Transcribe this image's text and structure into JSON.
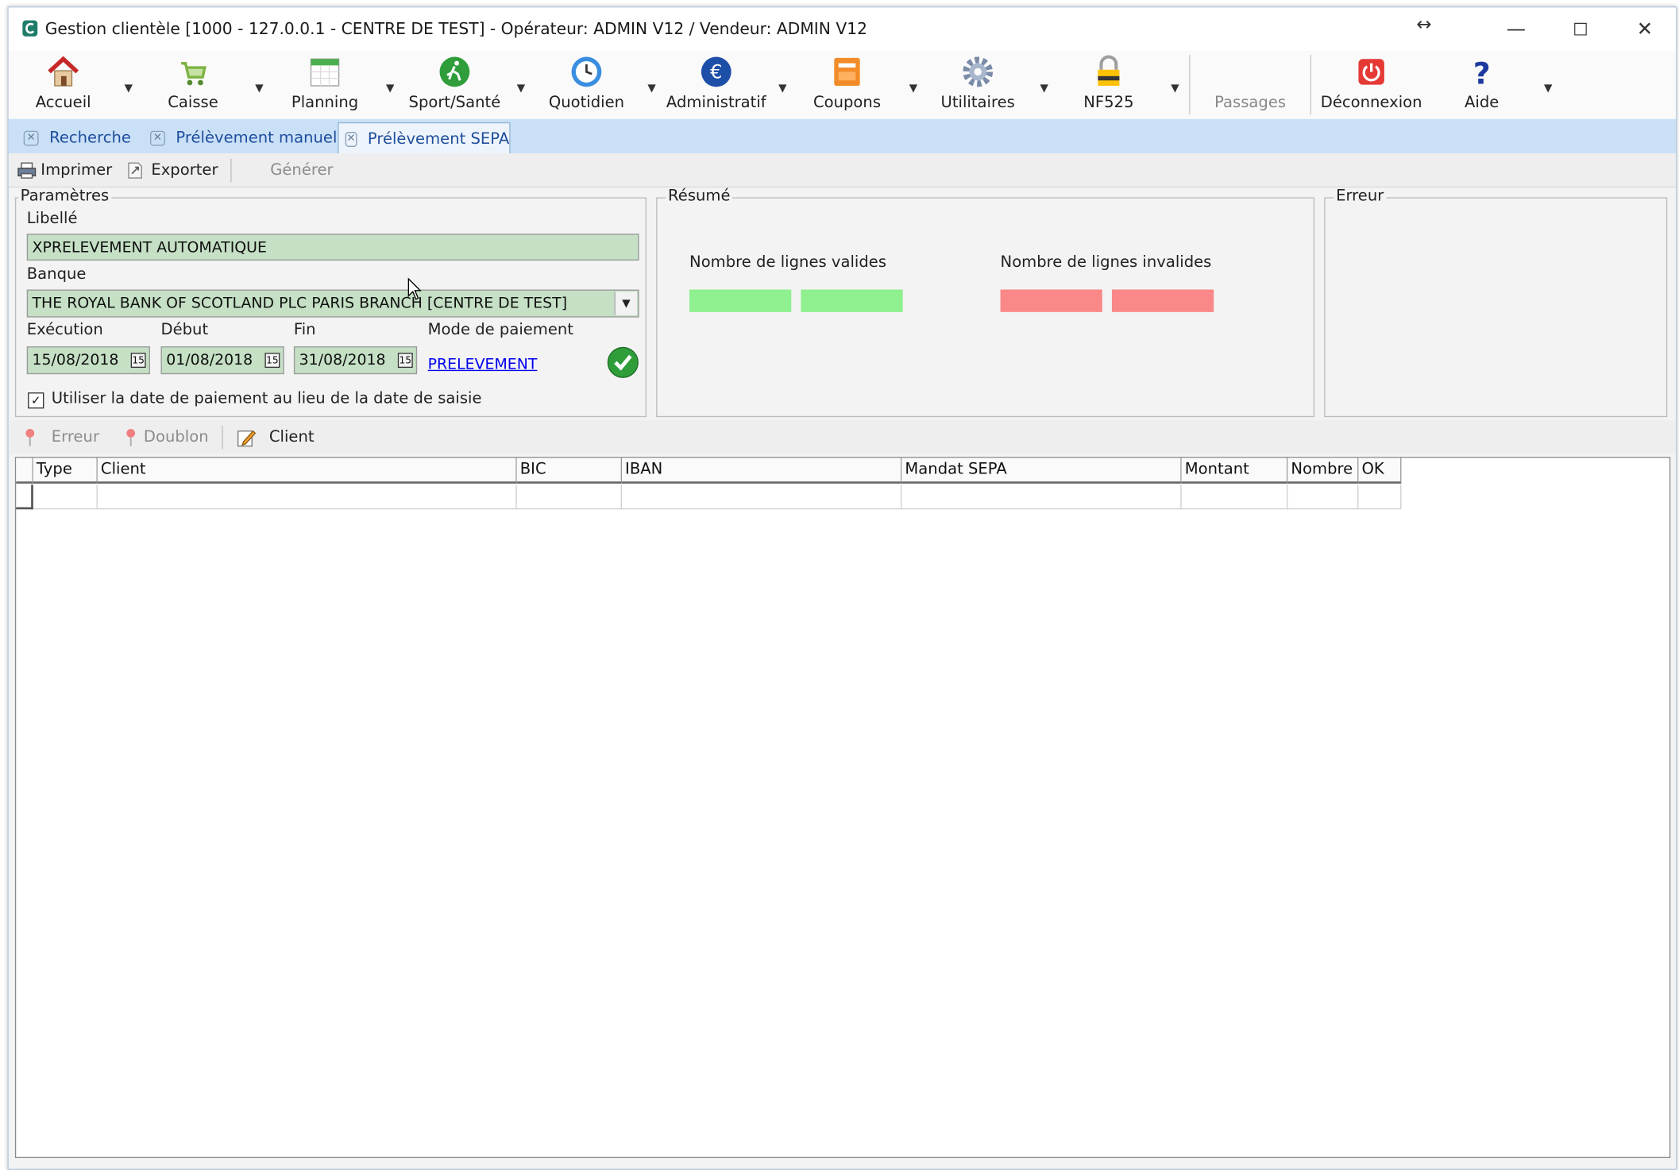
{
  "window": {
    "title": "Gestion clientèle [1000 - 127.0.0.1 - CENTRE DE TEST] - Opérateur: ADMIN V12 / Vendeur: ADMIN V12",
    "resize_glyph": "↔",
    "minimize": "—",
    "maximize": "☐",
    "close": "✕"
  },
  "ribbon": {
    "accueil": "Accueil",
    "caisse": "Caisse",
    "planning": "Planning",
    "sport": "Sport/Santé",
    "quotidien": "Quotidien",
    "administratif": "Administratif",
    "coupons": "Coupons",
    "utilitaires": "Utilitaires",
    "nf525": "NF525",
    "passages": "Passages",
    "deconnexion": "Déconnexion",
    "aide": "Aide"
  },
  "tabs": {
    "t1": "Recherche",
    "t2": "Prélèvement manuel",
    "t3": "Prélèvement SEPA",
    "active": "Prélèvement SEPA"
  },
  "toolbar": {
    "imprimer": "Imprimer",
    "exporter": "Exporter",
    "generer": "Générer"
  },
  "parametres": {
    "title": "Paramètres",
    "libelle_label": "Libellé",
    "libelle_value": "XPRELEVEMENT AUTOMATIQUE",
    "banque_label": "Banque",
    "banque_value": "THE ROYAL BANK OF SCOTLAND PLC PARIS BRANCH [CENTRE DE TEST]",
    "execution_label": "Exécution",
    "execution_value": "15/08/2018",
    "debut_label": "Début",
    "debut_value": "01/08/2018",
    "fin_label": "Fin",
    "fin_value": "31/08/2018",
    "mode_label": "Mode de paiement",
    "mode_value": "PRELEVEMENT",
    "calendar_glyph": "15",
    "checkbox_label": "Utiliser la date de paiement au lieu de la date de saisie",
    "checkbox_checked": true,
    "checkbox_glyph": "✓"
  },
  "resume": {
    "title": "Résumé",
    "valides_label": "Nombre de lignes valides",
    "invalides_label": "Nombre de lignes invalides",
    "valid_color": "#8ef08e",
    "invalid_color": "#fa8888"
  },
  "erreur": {
    "title": "Erreur"
  },
  "toolbar2": {
    "erreur": "Erreur",
    "doublon": "Doublon",
    "client": "Client"
  },
  "grid": {
    "columns": [
      "Type",
      "Client",
      "BIC",
      "IBAN",
      "Mandat SEPA",
      "Montant",
      "Nombre",
      "OK"
    ],
    "rows": []
  },
  "colors": {
    "tab_bar": "#c9e0f7",
    "field_green": "#c5e0c5",
    "link_blue": "#0000ee",
    "tab_text": "#1f4e9c"
  }
}
